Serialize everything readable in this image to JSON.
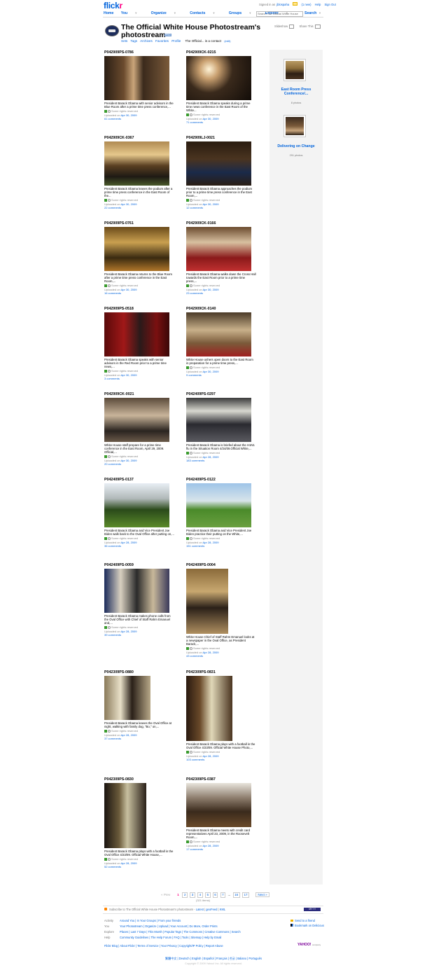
{
  "site": {
    "logo_part1": "flick",
    "logo_part2": "r"
  },
  "userbar": {
    "signed_in_prefix": "Signed in as",
    "username": "jblospaha",
    "new_count": "(1 new)",
    "help": "Help",
    "sign_out": "Sign Out"
  },
  "nav": {
    "items": [
      "Home",
      "You",
      "Organize",
      "Contacts",
      "Groups",
      "Explore"
    ],
    "search_placeholder": "Search The Official White House",
    "search_button": "Search"
  },
  "header": {
    "title": "The Official White House Photostream's photostream",
    "pro": "PRO",
    "links": [
      "Sets",
      "Tags",
      "Archives",
      "Favorites",
      "Profile"
    ],
    "contact_text": "The Official... is a contact",
    "contact_edit": "(edit)",
    "slideshow": "Slideshow",
    "share": "Share This"
  },
  "sidebar": {
    "sets": [
      {
        "title": "East Room Press Conference/...",
        "count": "8 photos"
      },
      {
        "title": "Delivering on Change",
        "count": "291 photos"
      }
    ]
  },
  "photos": [
    {
      "title": "P042909PS-0786",
      "desc": "President Barack Obama with senior advisors in the Blue Room after a prime time press conference,...",
      "license": "Some rights reserved",
      "uploaded": "Uploaded on",
      "date": "Apr 30, 2009",
      "comments": "61 comments"
    },
    {
      "title": "P042909CK-0215",
      "desc": "President Barack Obama speaks during a prime time news conference in the East Room of the White...",
      "license": "Some rights reserved",
      "uploaded": "Uploaded on",
      "date": "Apr 30, 2009",
      "comments": "71 comments"
    },
    {
      "title": "P042909CK-0367",
      "desc": "President Barack Obama leaves the podium after a prime time press conference in the East Room of the...",
      "license": "Some rights reserved",
      "uploaded": "Uploaded on",
      "date": "Apr 30, 2009",
      "comments": "22 comments"
    },
    {
      "title": "P042909LJ-0021",
      "desc": "President Barack Obama approaches the podium prior to a prime time press conference in the East Room,...",
      "license": "Some rights reserved",
      "uploaded": "Uploaded on",
      "date": "Apr 30, 2009",
      "comments": "12 comments"
    },
    {
      "title": "P042909PS-0761",
      "desc": "President Barack Obama returns to the Blue Room after a prime time press conference in the East Room,...",
      "license": "Some rights reserved",
      "uploaded": "Uploaded on",
      "date": "Apr 30, 2009",
      "comments": "16 comments"
    },
    {
      "title": "P042909CK-0166",
      "desc": "President Barack Obama walks down the Cross Hall towards the East Room prior to a prime time press,...",
      "license": "Some rights reserved",
      "uploaded": "Uploaded on",
      "date": "Apr 30, 2009",
      "comments": "23 comments"
    },
    {
      "title": "P042909PS-0518",
      "desc": "President Barack Obama speaks with senior advisors in the Red Room prior to a prime time news,...",
      "license": "Some rights reserved",
      "uploaded": "Uploaded on",
      "date": "Apr 30, 2009",
      "comments": "3 comments"
    },
    {
      "title": "P042909CK-0140",
      "desc": "White House ushers open doors to the East Room in preparation for a prime time press,...",
      "license": "Some rights reserved",
      "uploaded": "Uploaded on",
      "date": "Apr 30, 2009",
      "comments": "9 comments"
    },
    {
      "title": "P042909CK-0021",
      "desc": "White House staff prepare for a prime time conference in the East Room, April 29, 2009. Official,...",
      "license": "Some rights reserved",
      "uploaded": "Uploaded on",
      "date": "Apr 30, 2009",
      "comments": "20 comments"
    },
    {
      "title": "P042409PS-0297",
      "desc": "President Barack Obama is briefed about the H1N1 flu in the Situation Room 4/24/09.Official White,...",
      "license": "Some rights reserved",
      "uploaded": "Uploaded on",
      "date": "Apr 28, 2009",
      "comments": "183 comments"
    },
    {
      "title": "P042409PS-0137",
      "desc": "President Barack Obama and Vice President Joe Biden walk back to the Oval Office after putting on,...",
      "license": "Some rights reserved",
      "uploaded": "Uploaded on",
      "date": "Apr 28, 2009",
      "comments": "36 comments"
    },
    {
      "title": "P042409PS-0122",
      "desc": "President Barack Obama and Vice President Joe Biden practice their putting on the White,...",
      "license": "Some rights reserved",
      "uploaded": "Uploaded on",
      "date": "Apr 28, 2009",
      "comments": "151 comments"
    },
    {
      "title": "P042409PS-0059",
      "desc": "President Barack Obama makes phone calls from the Oval Office with Chief of Staff Rahm Emanuel and,...",
      "license": "Some rights reserved",
      "uploaded": "Uploaded on",
      "date": "Apr 28, 2009",
      "comments": "39 comments"
    },
    {
      "title": "P042409PS-0004",
      "desc": "White House Chief of Staff Rahm Emanuel looks at a newspaper in the Oval Office, as President Barack,...",
      "license": "Some rights reserved",
      "uploaded": "Uploaded on",
      "date": "Apr 28, 2009",
      "comments": "43 comments"
    },
    {
      "title": "P042309PS-0880",
      "desc": "President Barack Obama leaves the Oval Office at night, walking with family dog, \"Bo,\" on,...",
      "license": "Some rights reserved",
      "uploaded": "Uploaded on",
      "date": "Apr 28, 2009",
      "comments": "37 comments"
    },
    {
      "title": "P042309PS-0831",
      "desc": "President Barack Obama plays with a football in the Oval Office 4/23/09. Official White House Photo,...",
      "license": "Some rights reserved",
      "uploaded": "Uploaded on",
      "date": "Apr 28, 2009",
      "comments": "103 comments"
    },
    {
      "title": "P042309PS-0830",
      "desc": "President Barack Obama plays with a football in the Oval Office 4/23/09. Official White House,...",
      "license": "Some rights reserved",
      "uploaded": "Uploaded on",
      "date": "Apr 28, 2009",
      "comments": "52 comments"
    },
    {
      "title": "P042309PS-0387",
      "desc": "President Barack Obama meets with credit card representatives April 23, 2009, in the Roosevelt Room,...",
      "license": "Some rights reserved",
      "uploaded": "Uploaded on",
      "date": "Apr 28, 2009",
      "comments": "17 comments"
    }
  ],
  "pagination": {
    "prev": "« Prev",
    "pages": [
      "1",
      "2",
      "3",
      "4",
      "5",
      "6",
      "7",
      "...",
      "16",
      "17"
    ],
    "current": "1",
    "next": "Next »",
    "items": "(321 items)"
  },
  "rss": {
    "text": "Subscribe to The Official White House Photostream's photostream -",
    "latest": "Latest",
    "geofeed": "geoFeed",
    "kml": "KML",
    "my_yahoo": "MY Y!"
  },
  "footer": {
    "rows": [
      {
        "label": "Activity",
        "links": "Around You | In Your Groups | From your friends"
      },
      {
        "label": "You",
        "links": "Your Photostream | Organize | Upload | Your Account | Do More, Order Prints"
      },
      {
        "label": "Explore",
        "links": "Places | Last 7 Days | This Month | Popular Tags | The Commons | Creative Commons | Search"
      },
      {
        "label": "Help",
        "links": "Community Guidelines | The Help Forum | FAQ | Tools | Sitemap | Help by Email"
      }
    ],
    "send_friend": "Send to a friend",
    "bookmark": "Bookmark on Delicious",
    "bottom_links": "Flickr Blog | About Flickr | Terms of Service | Your Privacy | Copyright/IP Policy | Report Abuse",
    "yahoo": "YAHOO!",
    "yahoo_company": "company",
    "languages": "繁體中文 | Deutsch | English | Español | Français | 한글 | Italiano | Português",
    "copyright": "Copyright © 2009 Yahoo! Inc. All rights reserved."
  },
  "colors": {
    "link": "#0063dc",
    "brand_pink": "#ff0084",
    "sidebar_bg": "#f3f3f3"
  }
}
